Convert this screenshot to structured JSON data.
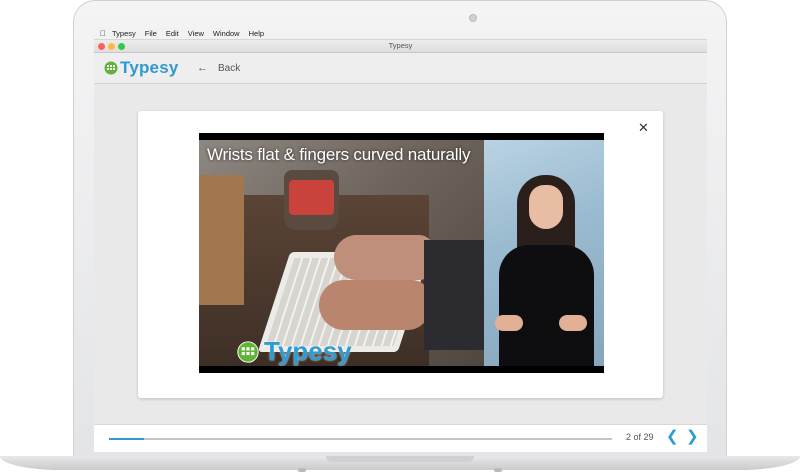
{
  "menubar": {
    "apple_icon": "apple-icon",
    "items": [
      "Typesy",
      "File",
      "Edit",
      "View",
      "Window",
      "Help"
    ]
  },
  "window": {
    "title": "Typesy",
    "traffic_lights": {
      "close": "#fc605c",
      "minimize": "#fdbc40",
      "zoom": "#34c84a"
    }
  },
  "header": {
    "logo_text": "Typesy",
    "back_label": "Back",
    "back_icon": "arrow-left-icon"
  },
  "lesson": {
    "close_icon": "close-icon",
    "video_headline": "Wrists flat & fingers curved naturally",
    "watermark_text": "Typesy"
  },
  "footer": {
    "page_label": "2 of 29",
    "progress": 0.069,
    "prev_icon": "chevron-left-icon",
    "next_icon": "chevron-right-icon"
  },
  "colors": {
    "brand_blue": "#2f9bd1",
    "logo_green": "#5fb336",
    "background": "#e9e9ea"
  }
}
